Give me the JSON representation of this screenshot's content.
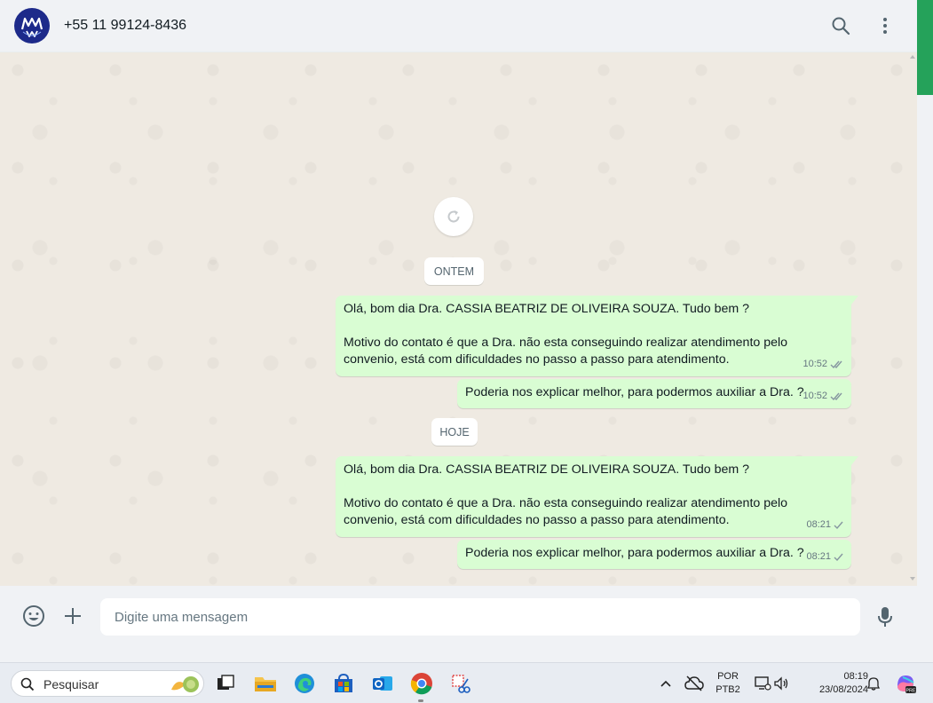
{
  "header": {
    "contact_name": "+55 11 99124-8436",
    "avatar_icon": "clinic-logo-avatar",
    "search_icon": "search-icon",
    "menu_icon": "more-vertical-icon"
  },
  "chat": {
    "reload_icon": "refresh-icon",
    "days": [
      {
        "label": "ONTEM",
        "messages": [
          {
            "lines": [
              "Olá, bom dia Dra. CASSIA BEATRIZ DE OLIVEIRA SOUZA. Tudo bem ?",
              "",
              "Motivo do contato é que a Dra. não esta conseguindo realizar atendimento pelo",
              "convenio, está com dificuldades no passo a passo para atendimento."
            ],
            "time": "10:52",
            "status": "double-check"
          },
          {
            "lines": [
              "Poderia nos explicar melhor, para podermos auxiliar a Dra. ?"
            ],
            "time": "10:52",
            "status": "double-check"
          }
        ]
      },
      {
        "label": "HOJE",
        "messages": [
          {
            "lines": [
              "Olá, bom dia Dra. CASSIA BEATRIZ DE OLIVEIRA SOUZA. Tudo bem ?",
              "",
              "Motivo do contato é que a Dra. não esta conseguindo realizar atendimento pelo",
              "convenio, está com dificuldades no passo a passo para atendimento."
            ],
            "time": "08:21",
            "status": "single-check"
          },
          {
            "lines": [
              "Poderia nos explicar melhor, para podermos auxiliar a Dra. ?"
            ],
            "time": "08:21",
            "status": "single-check"
          }
        ]
      }
    ]
  },
  "composer": {
    "placeholder": "Digite uma mensagem",
    "emoji_icon": "emoji-icon",
    "attach_icon": "plus-icon",
    "mic_icon": "microphone-icon"
  },
  "taskbar": {
    "search_label": "Pesquisar",
    "apps": [
      "task-view-icon",
      "file-explorer-icon",
      "edge-icon",
      "store-icon",
      "outlook-icon",
      "chrome-icon",
      "snipping-tool-icon"
    ],
    "language_line1": "POR",
    "language_line2": "PTB2",
    "time": "08:19",
    "date": "23/08/2024"
  },
  "colors": {
    "bubble_out": "#d9fdd3",
    "chat_bg": "#efeae2",
    "header_bg": "#f0f2f5",
    "accent_green": "#25a25a",
    "read_tick": "#8696a0"
  }
}
